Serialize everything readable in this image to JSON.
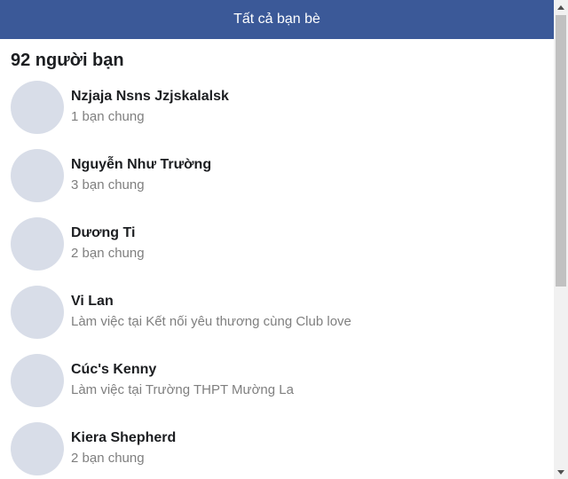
{
  "header": {
    "title": "Tất cả bạn bè"
  },
  "friends_count_label": "92 người bạn",
  "friends": [
    {
      "name": "Nzjaja Nsns Jzjskalalsk",
      "subtitle": "1 bạn chung"
    },
    {
      "name": "Nguyễn Như Trường",
      "subtitle": "3 bạn chung"
    },
    {
      "name": "Dương Ti",
      "subtitle": "2 bạn chung"
    },
    {
      "name": "Vi Lan",
      "subtitle": "Làm việc tại Kết nối yêu thương cùng Club love"
    },
    {
      "name": "Cúc's Kenny",
      "subtitle": "Làm việc tại Trường THPT Mường La"
    },
    {
      "name": "Kiera Shepherd",
      "subtitle": "2 bạn chung"
    }
  ],
  "colors": {
    "header_bg": "#3b5998",
    "avatar_placeholder": "#d8dde8",
    "subtitle_text": "#7f7f7f"
  },
  "icons": {
    "scroll_up": "triangle-up-icon",
    "scroll_down": "triangle-down-icon"
  }
}
